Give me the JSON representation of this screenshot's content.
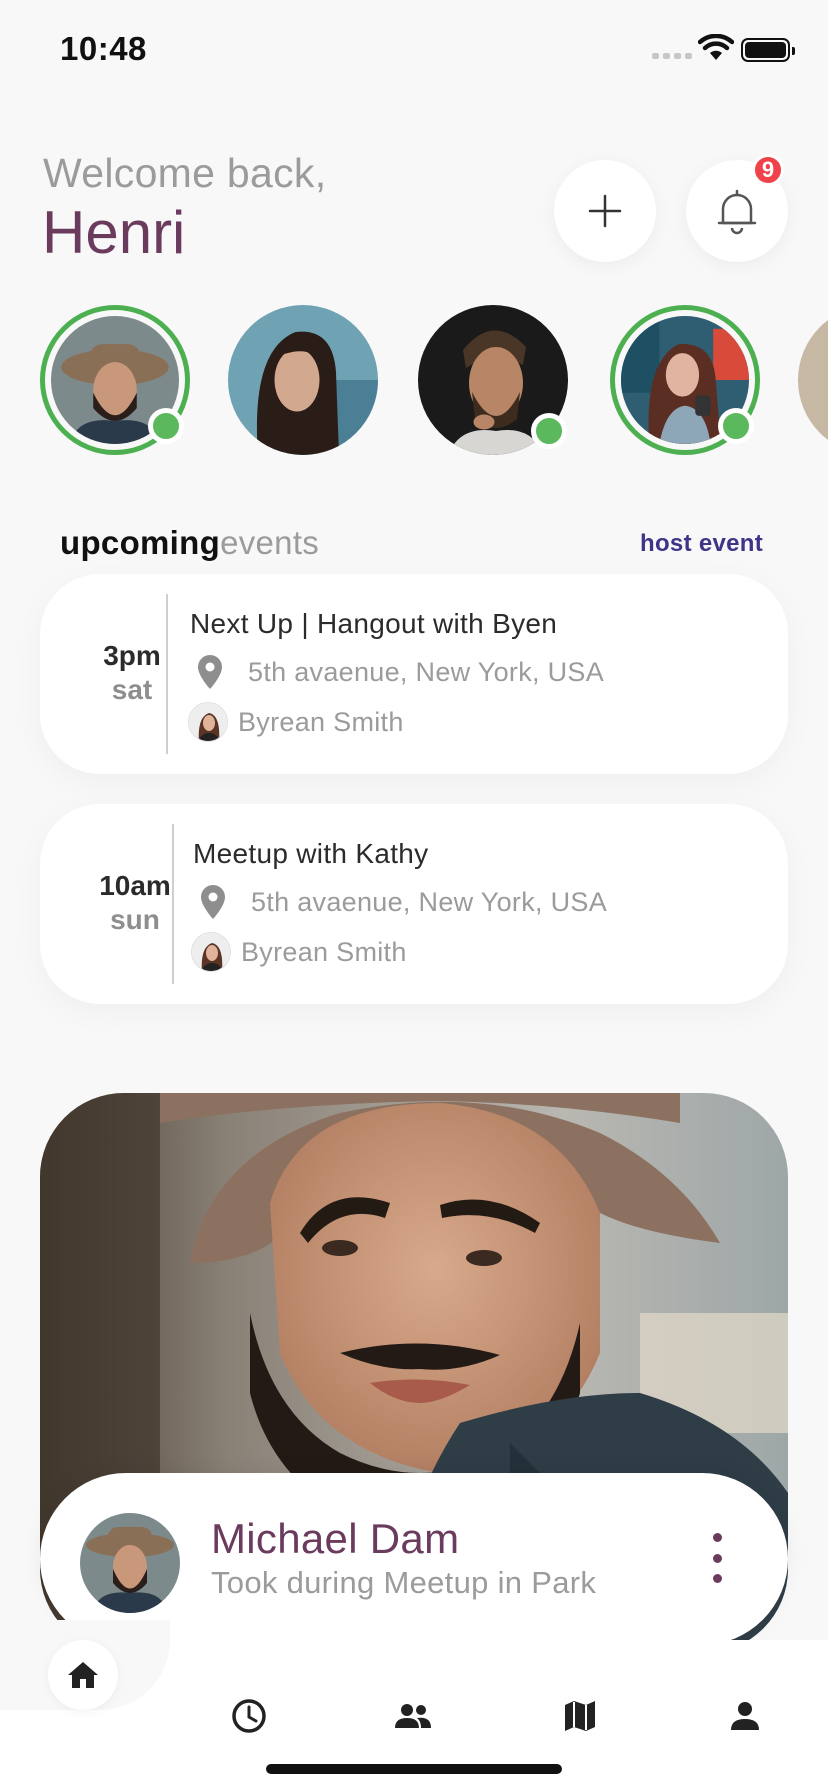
{
  "status_bar": {
    "time": "10:48"
  },
  "header": {
    "greeting": "Welcome back,",
    "user_name": "Henri",
    "add_icon": "plus-icon",
    "notifications_icon": "bell-icon",
    "notification_count": "9"
  },
  "stories": [
    {
      "icon": "avatar",
      "ring": true,
      "online": true
    },
    {
      "icon": "avatar",
      "ring": false,
      "online": false
    },
    {
      "icon": "avatar",
      "ring": false,
      "online": true
    },
    {
      "icon": "avatar",
      "ring": true,
      "online": true
    },
    {
      "icon": "avatar",
      "ring": false,
      "online": false
    }
  ],
  "upcoming": {
    "title_strong": "upcoming",
    "title_light": "events",
    "host_event_label": "host event",
    "events": [
      {
        "time": "3pm",
        "day": "sat",
        "title": "Next Up | Hangout with Byen",
        "location": "5th avaenue, New York, USA",
        "host": "Byrean Smith"
      },
      {
        "time": "10am",
        "day": "sun",
        "title": "Meetup with Kathy",
        "location": "5th avaenue, New York, USA",
        "host": "Byrean Smith"
      }
    ]
  },
  "featured_photo": {
    "name": "Michael Dam",
    "caption": "Took during Meetup in Park",
    "more_icon": "more-vertical-icon"
  },
  "bottom_nav": {
    "items": [
      "home-icon",
      "clock-icon",
      "people-icon",
      "map-icon",
      "person-icon"
    ],
    "active": "home-icon"
  },
  "colors": {
    "brand": "#6b3b5e",
    "accent": "#3f3588",
    "online": "#5cb85c",
    "badge": "#f0424a",
    "muted": "#9b9b9b",
    "background": "#f8f8f8"
  }
}
